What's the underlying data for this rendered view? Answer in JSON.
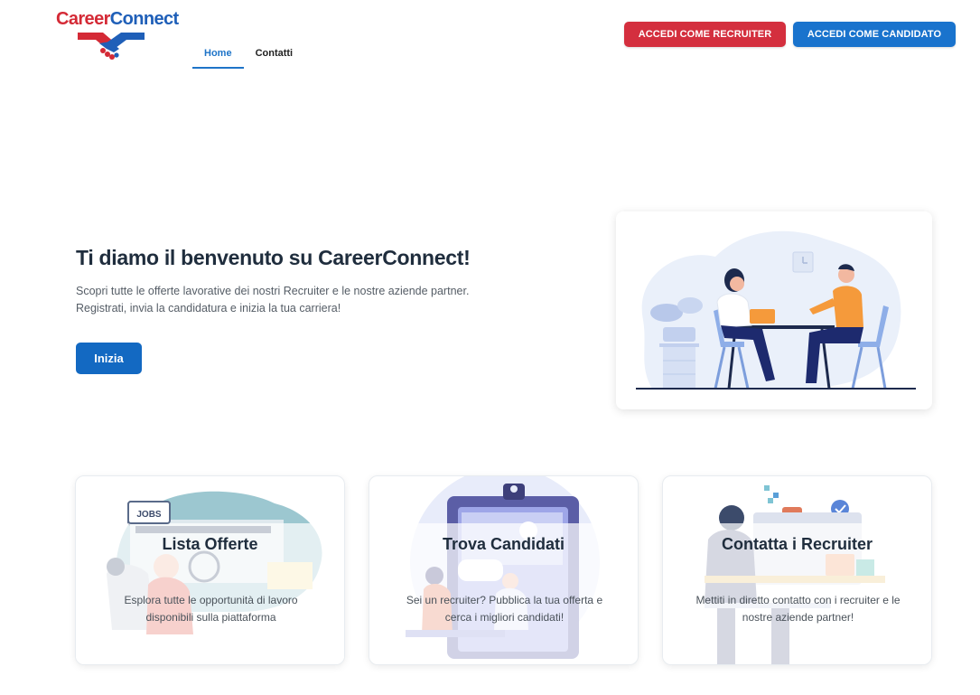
{
  "header": {
    "logo": {
      "career": "Career",
      "connect": "Connect"
    },
    "nav": [
      {
        "label": "Home",
        "active": true
      },
      {
        "label": "Contatti",
        "active": false
      }
    ],
    "buttons": {
      "recruiter": "ACCEDI COME RECRUITER",
      "candidato": "ACCEDI COME CANDIDATO"
    }
  },
  "hero": {
    "title": "Ti diamo il benvenuto su CareerConnect!",
    "text_lines": [
      "Scopri tutte le offerte lavorative dei nostri Recruiter e le nostre aziende partner.",
      "Registrati, invia la candidatura e inizia la tua carriera!"
    ],
    "cta": "Inizia"
  },
  "features": [
    {
      "title": "Lista Offerte",
      "text_lines": [
        "Esplora tutte le opportunità di lavoro",
        "disponibili sulla piattaforma"
      ],
      "badge": "JOBS"
    },
    {
      "title": "Trova Candidati",
      "text_lines": [
        "Sei un recruiter? Pubblica la tua offerta e",
        "cerca i migliori candidati!"
      ]
    },
    {
      "title": "Contatta i Recruiter",
      "text_lines": [
        "Mettiti in diretto contatto con i recruiter e le",
        "nostre aziende partner!"
      ]
    }
  ],
  "colors": {
    "brand_red": "#d42f3e",
    "brand_blue": "#1973cd",
    "cta_blue": "#1369c2",
    "title_dark": "#1f2d3d"
  }
}
